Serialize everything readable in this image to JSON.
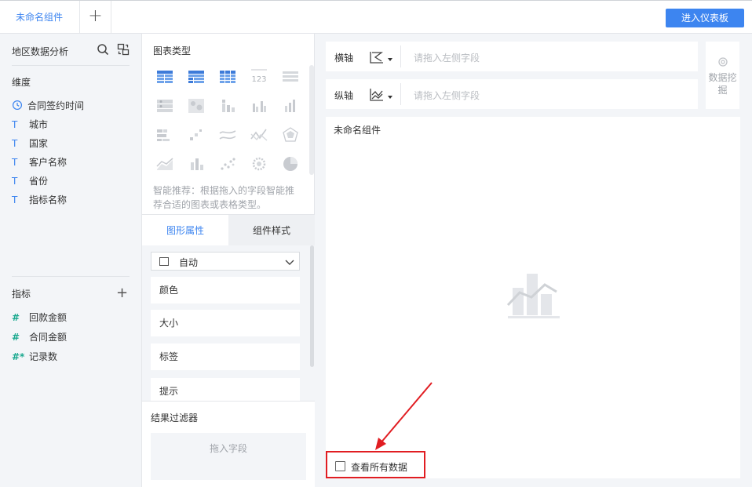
{
  "topbar": {
    "tab_label": "未命名组件",
    "add_tab_glyph": "+",
    "enter_dashboard_label": "进入仪表板",
    "accent_color": "#3d85f0"
  },
  "left": {
    "dataset_title": "地区数据分析",
    "dimensions_title": "维度",
    "dimensions": [
      {
        "icon": "clock-icon",
        "label": "合同签约时间"
      },
      {
        "icon": "text-type-icon",
        "label": "城市"
      },
      {
        "icon": "text-type-icon",
        "label": "国家"
      },
      {
        "icon": "text-type-icon",
        "label": "客户名称"
      },
      {
        "icon": "text-type-icon",
        "label": "省份"
      },
      {
        "icon": "text-type-icon",
        "label": "指标名称"
      }
    ],
    "measures_title": "指标",
    "measures": [
      {
        "icon": "number-type-icon",
        "label": "回款金额"
      },
      {
        "icon": "number-type-icon",
        "label": "合同金额"
      },
      {
        "icon": "record-count-icon",
        "label": "记录数"
      }
    ],
    "dimension_glyphs": {
      "text": "T",
      "number": "#",
      "record": "#*"
    }
  },
  "middle": {
    "chart_type_title": "图表类型",
    "smart_tip": "智能推荐：根据拖入的字段智能推荐合适的图表或表格类型。",
    "tabs": {
      "shape_props": "图形属性",
      "component_style": "组件样式"
    },
    "shape_select_value": "自动",
    "props": [
      "颜色",
      "大小",
      "标签",
      "提示"
    ],
    "result_filter_title": "结果过滤器",
    "filter_drop_placeholder": "拖入字段",
    "number_chart_glyph": "123"
  },
  "right": {
    "x_axis_label": "横轴",
    "y_axis_label": "纵轴",
    "axis_placeholder": "请拖入左侧字段",
    "data_mining_label": "数据挖掘",
    "canvas_title": "未命名组件",
    "view_all_data_label": "查看所有数据"
  },
  "annotation": {
    "color": "#e11d22"
  }
}
